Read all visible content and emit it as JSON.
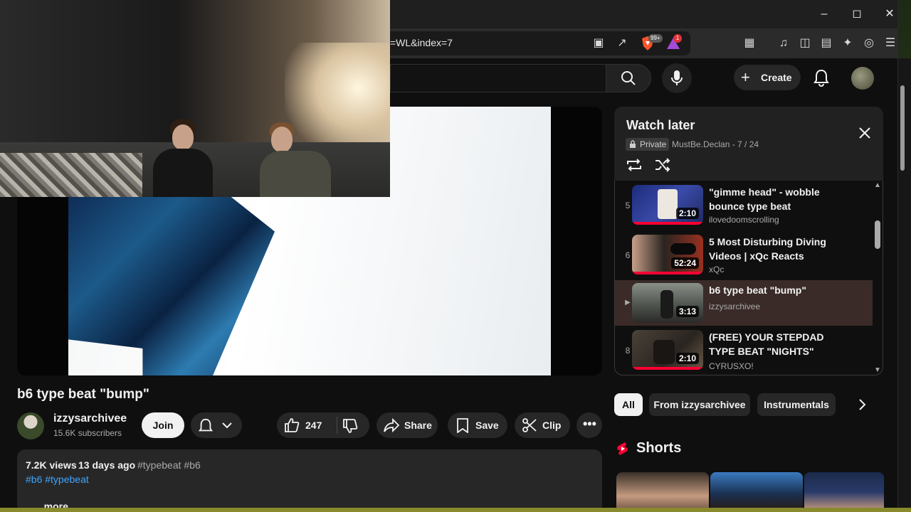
{
  "browser": {
    "url_fragment": "=WL&index=7",
    "brave_badge": "99+",
    "alert_badge": "1",
    "window_controls": [
      "minimize-icon",
      "maximize-icon",
      "close-icon"
    ]
  },
  "youtube_header": {
    "create_label": "Create"
  },
  "video": {
    "title": "b6 type beat \"bump\"",
    "channel_name": "izzysarchivee",
    "subscribers": "15.6K subscribers",
    "join_label": "Join",
    "like_count": "247",
    "share_label": "Share",
    "save_label": "Save",
    "clip_label": "Clip"
  },
  "description": {
    "views": "7.2K views",
    "date": "13 days ago",
    "inline_tags": "#typebeat #b6",
    "tags": "#b6 #typebeat",
    "more": "...more"
  },
  "playlist": {
    "title": "Watch later",
    "privacy": "Private",
    "owner_progress": "MustBe.Declan - 7 / 24",
    "items": [
      {
        "index": "5",
        "title": "\"gimme head\" - wobble bounce type beat",
        "channel": "ilovedoomscrolling",
        "duration": "2:10"
      },
      {
        "index": "6",
        "title": "5 Most Disturbing Diving Videos | xQc Reacts",
        "channel": "xQc",
        "duration": "52:24"
      },
      {
        "index": "▶",
        "title": "b6 type beat \"bump\"",
        "channel": "izzysarchivee",
        "duration": "3:13"
      },
      {
        "index": "8",
        "title": "(FREE) YOUR STEPDAD TYPE BEAT \"NIGHTS\"",
        "channel": "CYRUSXO!",
        "duration": "2:10"
      }
    ]
  },
  "chips": [
    "All",
    "From izzysarchivee",
    "Instrumentals"
  ],
  "shorts": {
    "title": "Shorts"
  },
  "colors": {
    "background": "#0f0f0f",
    "surface": "#272727",
    "accent_red": "#ff0033",
    "link_blue": "#3ea6ff",
    "text_primary": "#f1f1f1",
    "text_secondary": "#aaaaaa"
  }
}
